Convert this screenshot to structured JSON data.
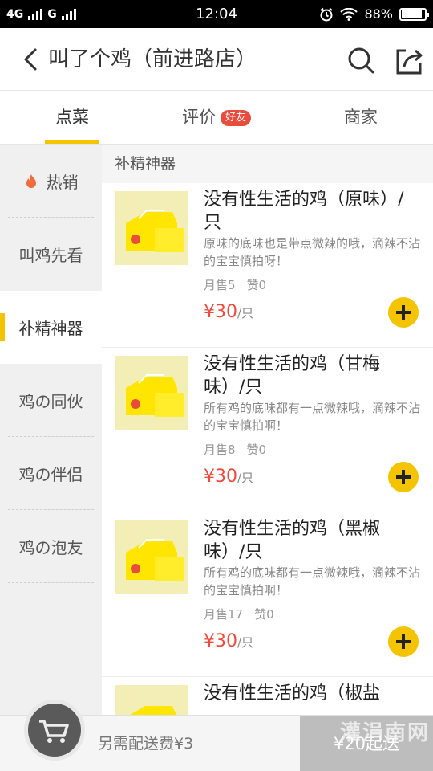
{
  "status": {
    "network1": "4G",
    "network2": "G",
    "time": "12:04",
    "battery": "88%"
  },
  "header": {
    "title": "叫了个鸡（前进路店）"
  },
  "tabs": [
    {
      "label": "点菜"
    },
    {
      "label": "评价",
      "badge": "好友"
    },
    {
      "label": "商家"
    }
  ],
  "sidebar": {
    "items": [
      {
        "label": "热销"
      },
      {
        "label": "叫鸡先看"
      },
      {
        "label": "补精神器"
      },
      {
        "label": "鸡の同伙"
      },
      {
        "label": "鸡の伴侣"
      },
      {
        "label": "鸡の泡友"
      }
    ]
  },
  "section": {
    "title": "补精神器"
  },
  "products": [
    {
      "name": "没有性生活的鸡（原味）/只",
      "desc": "原味的底味也是带点微辣的哦，滴辣不沾的宝宝慎拍呀！",
      "sales": "月售5",
      "likes": "赞0",
      "price": "¥30",
      "unit": "/只"
    },
    {
      "name": "没有性生活的鸡（甘梅味）/只",
      "desc": "所有鸡的底味都有一点微辣哦，滴辣不沾的宝宝慎拍啊！",
      "sales": "月售8",
      "likes": "赞0",
      "price": "¥30",
      "unit": "/只"
    },
    {
      "name": "没有性生活的鸡（黑椒味）/只",
      "desc": "所有鸡的底味都有一点微辣哦，滴辣不沾的宝宝慎拍啊！",
      "sales": "月售17",
      "likes": "赞0",
      "price": "¥30",
      "unit": "/只"
    },
    {
      "name": "没有性生活的鸡（椒盐",
      "desc": "",
      "sales": "",
      "likes": "",
      "price": "",
      "unit": ""
    }
  ],
  "bottom": {
    "delivery": "另需配送费¥3",
    "min_order": "¥20起送",
    "watermark": "灌涓南网"
  },
  "colors": {
    "accent": "#f5c400",
    "price": "#f04a3c",
    "badge": "#e94b3c"
  }
}
